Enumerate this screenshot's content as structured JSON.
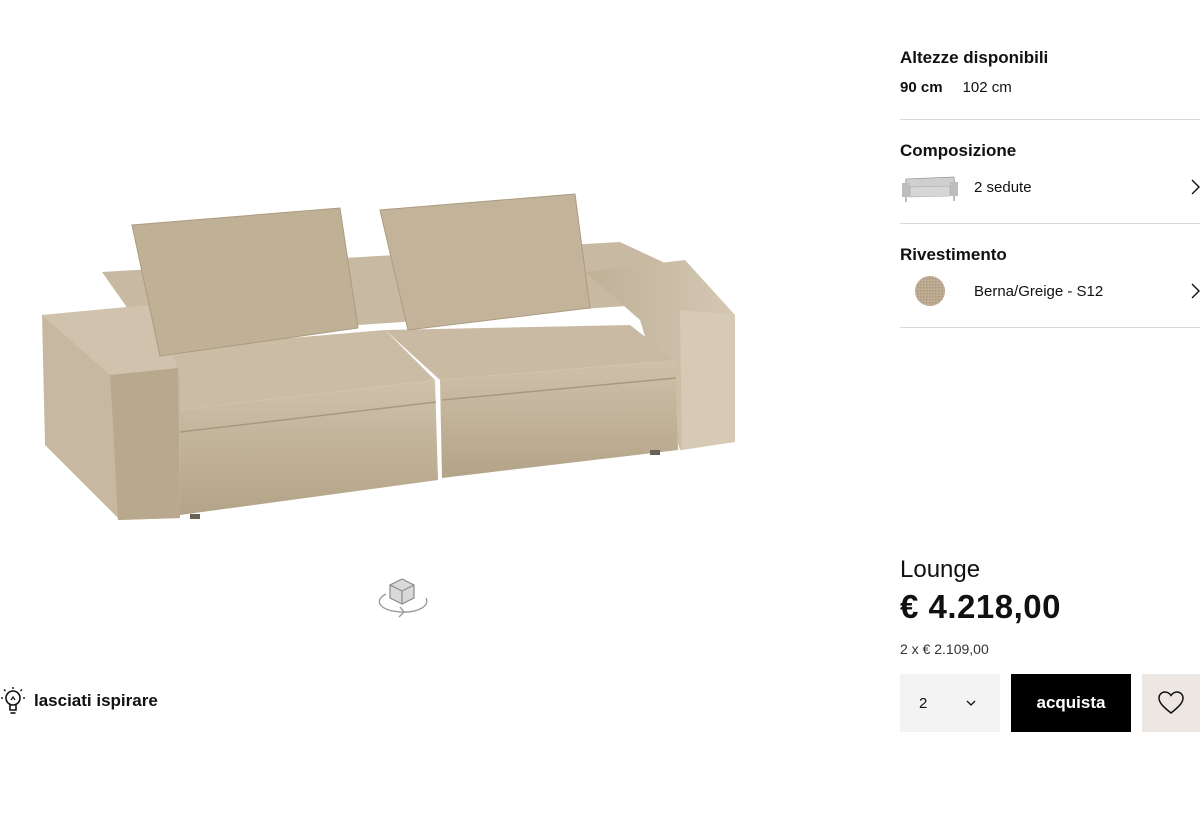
{
  "gallery": {
    "view360_icon": "3d-rotate-icon",
    "inspire_icon": "lightbulb-icon",
    "inspire_label": "lasciati ispirare"
  },
  "config": {
    "heights_title": "Altezze disponibili",
    "heights": [
      {
        "label": "90 cm",
        "selected": true
      },
      {
        "label": "102 cm",
        "selected": false
      }
    ],
    "composition_title": "Composizione",
    "composition_value": "2 sedute",
    "upholstery_title": "Rivestimento",
    "upholstery_value": "Berna/Greige - S12"
  },
  "product": {
    "name": "Lounge",
    "price": "€ 4.218,00",
    "installment": "2 x € 2.109,00"
  },
  "purchase": {
    "quantity": "2",
    "buy_label": "acquista",
    "wishlist_icon": "heart-icon"
  },
  "colors": {
    "fabric": "#c3b49c",
    "buy_bg": "#000000",
    "wish_bg": "#ede7e3",
    "qty_bg": "#f3f3f3"
  }
}
